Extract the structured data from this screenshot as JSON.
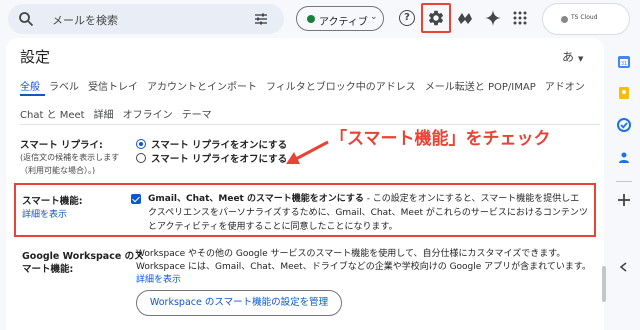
{
  "search": {
    "placeholder": "メールを検索"
  },
  "status": {
    "label": "アクティブ"
  },
  "account": {
    "label": "TS Cloud"
  },
  "settings": {
    "title": "設定",
    "language_indicator": "あ",
    "tabs_row1": [
      "全般",
      "ラベル",
      "受信トレイ",
      "アカウントとインポート",
      "フィルタとブロック中のアドレス",
      "メール転送と POP/IMAP",
      "アドオン"
    ],
    "tabs_row2": [
      "Chat と Meet",
      "詳細",
      "オフライン",
      "テーマ"
    ],
    "smart_reply": {
      "label": "スマート リプライ:",
      "sub1": "(返信文の候補を表示します",
      "sub2": "（利用可能な場合）。)",
      "option_on": "スマート リプライをオンにする",
      "option_off": "スマート リプライをオフにする"
    },
    "annotation": "「スマート機能」をチェック",
    "smart_features": {
      "label": "スマート機能:",
      "link": "詳細を表示",
      "checkbox_bold": "Gmail、Chat、Meet のスマート機能をオンにする",
      "checkbox_rest": " - この設定をオンにすると、スマート機能を提供しエクスペリエンスをパーソナライズするために、Gmail、Chat、Meet がこれらのサービスにおけるコンテンツとアクティビティを使用することに同意したことになります。"
    },
    "workspace": {
      "label_line1": "Google Workspace のス",
      "label_line2": "マート機能:",
      "desc": "Workspace やその他の Google サービスのスマート機能を使用して、自分仕様にカスタマイズできます。Workspace には、Gmail、Chat、Meet、ドライブなどの企業や学校向けの Google アプリが含まれています。",
      "link": "詳細を表示",
      "button": "Workspace のスマート機能の設定を管理"
    }
  },
  "colors": {
    "accent": "#0b57d0",
    "highlight": "#ea4335"
  }
}
